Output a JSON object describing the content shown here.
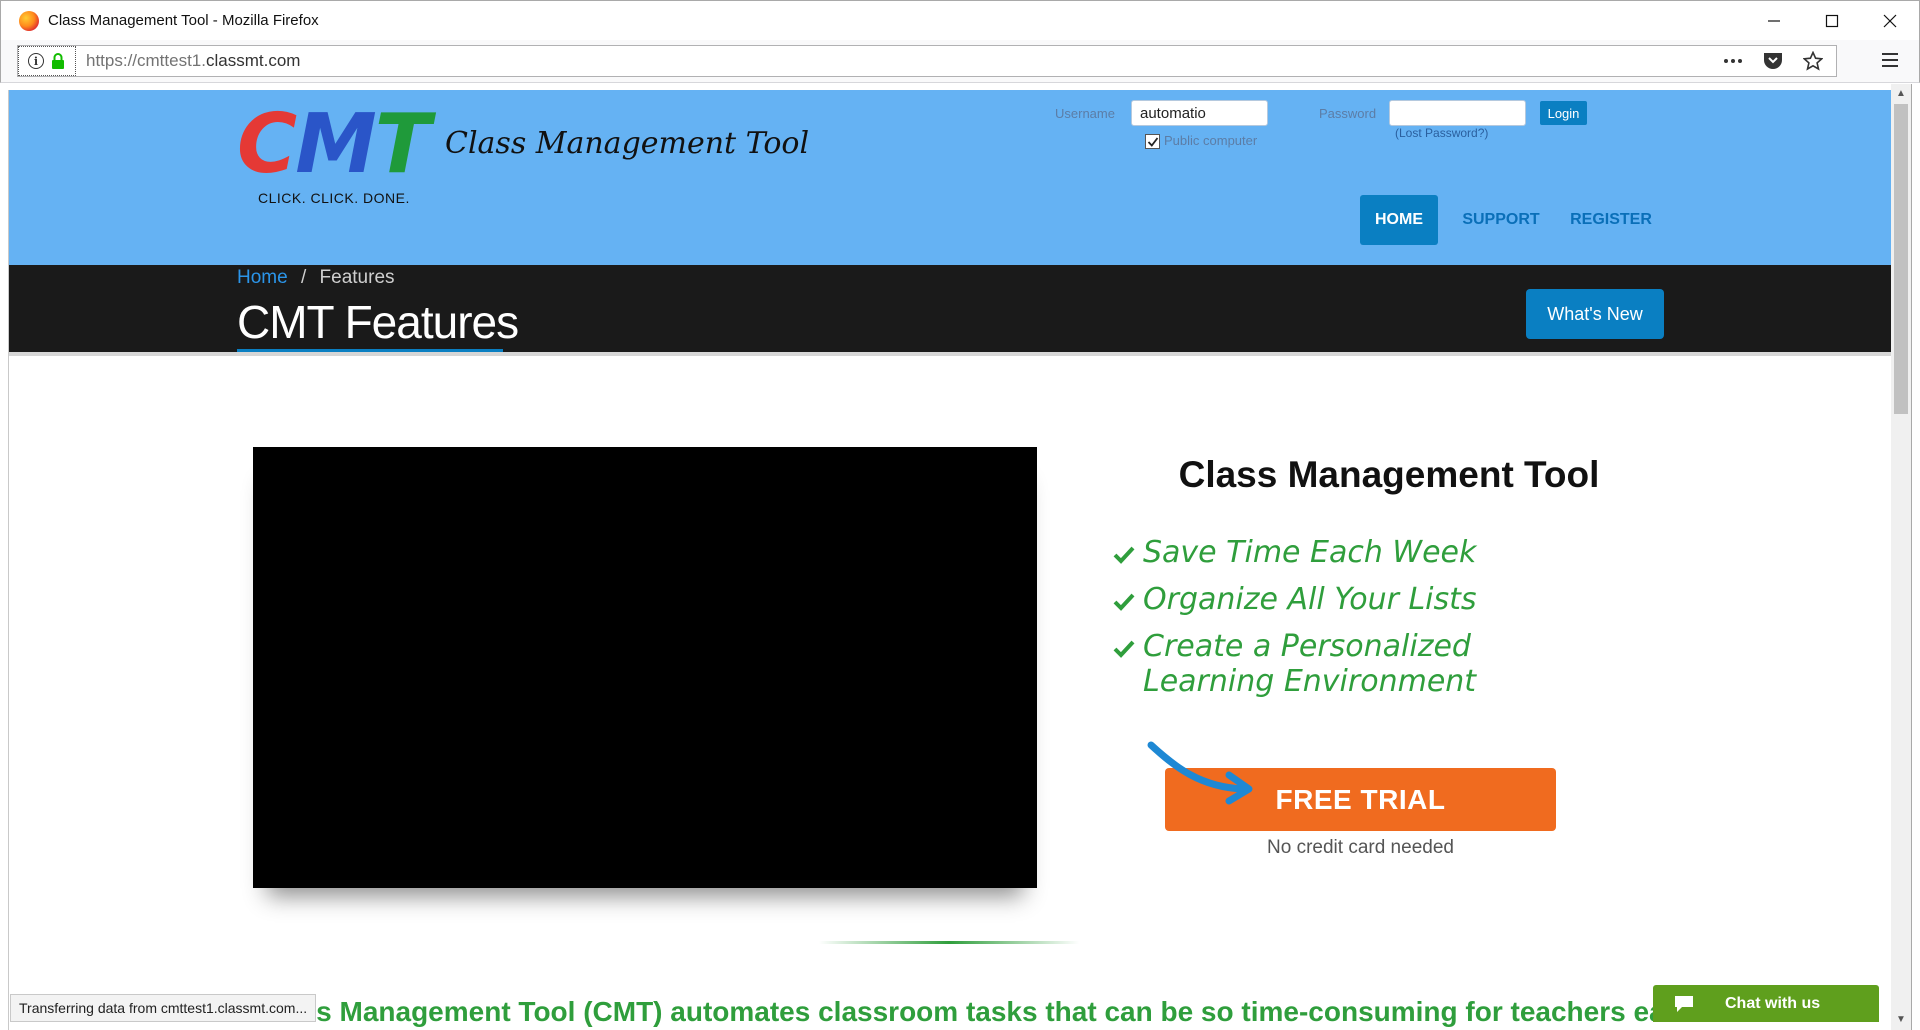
{
  "browser": {
    "window_title": "Class Management Tool - Mozilla Firefox",
    "url_prefix": "https://cmttest1.",
    "url_domain": "classmt.com",
    "status_text": "Transferring data from cmttest1.classmt.com..."
  },
  "header": {
    "logo_c": "C",
    "logo_m": "M",
    "logo_t": "T",
    "logo_tagline": "CLICK. CLICK. DONE.",
    "site_name": "Class Management Tool",
    "login": {
      "username_label": "Username",
      "username_value": "automatio",
      "password_label": "Password",
      "password_value": "",
      "public_computer_label": "Public computer",
      "public_computer_checked": true,
      "lost_password": "(Lost Password?)",
      "login_button": "Login"
    },
    "nav": [
      {
        "label": "HOME",
        "active": true
      },
      {
        "label": "SUPPORT",
        "active": false
      },
      {
        "label": "REGISTER",
        "active": false
      }
    ]
  },
  "titlebar": {
    "breadcrumb_home": "Home",
    "breadcrumb_sep": "/",
    "breadcrumb_current": "Features",
    "page_title": "CMT Features",
    "whats_new_button": "What's New"
  },
  "content": {
    "product_title": "Class Management Tool",
    "benefits": [
      "Save Time Each Week",
      "Organize All Your Lists",
      "Create a Personalized Learning Environment"
    ],
    "cta_button": "FREE TRIAL",
    "cta_note": "No credit card needed",
    "intro_text": "Class Management Tool (CMT) automates classroom tasks that can be so time-consuming for teachers each"
  },
  "chat": {
    "label": "Chat with us"
  },
  "colors": {
    "header_bg": "#65b2f3",
    "accent_blue": "#0a7fc2",
    "dark_band": "#1a1a1a",
    "cta_orange": "#f06b1f",
    "benefit_green": "#2f9e3c",
    "chat_green": "#5f9f1d"
  },
  "icons": [
    "firefox-logo-icon",
    "info-icon",
    "lock-icon",
    "more-icon",
    "pocket-icon",
    "star-icon",
    "menu-icon",
    "check-icon",
    "arrow-icon",
    "chat-bubble-icon"
  ]
}
